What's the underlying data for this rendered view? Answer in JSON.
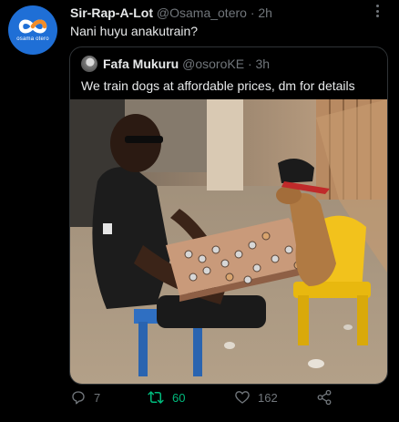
{
  "tweet": {
    "display_name": "Sir-Rap-A-Lot",
    "handle": "@Osama_otero",
    "separator": "·",
    "time": "2h",
    "text": "Nani huyu anakutrain?",
    "avatar_text": "osama otero",
    "avatar_color": "#1f6fd6"
  },
  "quoted_tweet": {
    "display_name": "Fafa Mukuru",
    "handle": "@osoroKE",
    "separator": "·",
    "time": "3h",
    "text": "We train dogs at affordable prices, dm for details",
    "image_icon": "photo-man-training-dog-checkers"
  },
  "actions": {
    "reply_count": "7",
    "retweet_count": "60",
    "like_count": "162",
    "retweet_color": "#00ba7c",
    "icon_color": "#71767b"
  }
}
